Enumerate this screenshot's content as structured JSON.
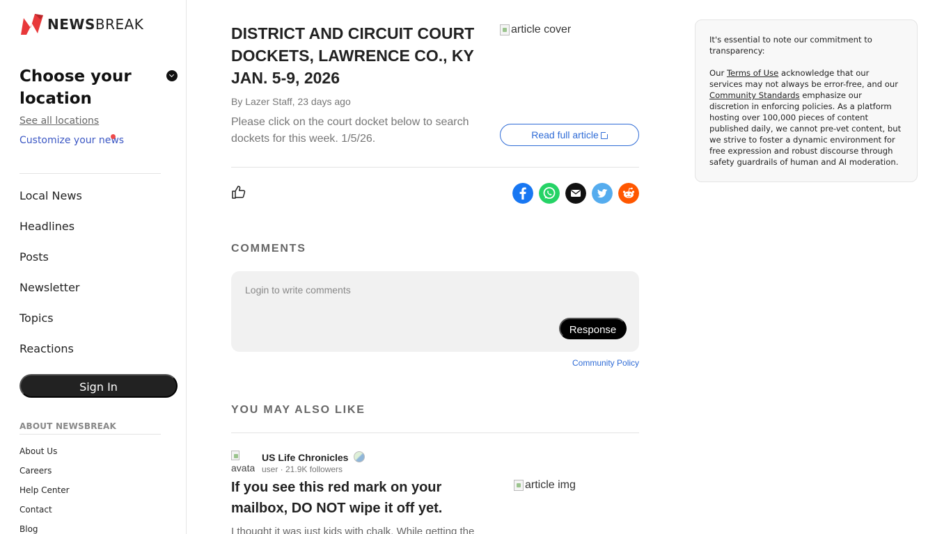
{
  "brand": {
    "name_bold": "NEWS",
    "name_rest": "BREAK"
  },
  "sidebar": {
    "location_title": "Choose your location",
    "see_all": "See all locations",
    "customize": "Customize your news",
    "nav": [
      "Local News",
      "Headlines",
      "Posts",
      "Newsletter",
      "Topics",
      "Reactions"
    ],
    "sign_in": "Sign In",
    "about_heading": "ABOUT NEWSBREAK",
    "footer_links": [
      "About Us",
      "Careers",
      "Help Center",
      "Contact",
      "Blog"
    ]
  },
  "article": {
    "title": "DISTRICT AND CIRCUIT COURT DOCKETS, LAWRENCE CO., KY JAN. 5-9, 2026",
    "cover_alt": "article cover",
    "byline": "By Lazer Staff, 23 days ago",
    "excerpt": "Please click on the court docket below to search dockets for this week. 1/5/26.",
    "read_full": "Read full article",
    "share_icons": [
      "facebook-icon",
      "whatsapp-icon",
      "email-icon",
      "twitter-icon",
      "reddit-icon"
    ]
  },
  "comments": {
    "heading": "COMMENTS",
    "placeholder": "Login to write comments",
    "response_button": "Response",
    "policy_link": "Community Policy"
  },
  "also_like": {
    "heading": "YOU MAY ALSO LIKE",
    "item": {
      "avatar_alt": "avatar",
      "source": "US Life Chronicles",
      "meta": "user · 21.9K followers",
      "title": "If you see this red mark on your mailbox, DO NOT wipe it off yet.",
      "img_alt": "article img",
      "snippet": "I thought it was just kids with chalk. While getting the"
    }
  },
  "notice": {
    "intro": "It's essential to note our commitment to transparency:",
    "p_start": "Our ",
    "terms_link": "Terms of Use",
    "p_mid": " acknowledge that our services may not always be error-free, and our ",
    "standards_link": "Community Standards",
    "p_end": " emphasize our discretion in enforcing policies. As a platform hosting over 100,000 pieces of content published daily, we cannot pre-vet content, but we strive to foster a dynamic environment for free expression and robust discourse through safety guardrails of human and AI moderation."
  },
  "colors": {
    "brand_red": "#e8383a",
    "link_blue": "#2e6bd6",
    "facebook": "#1877f2",
    "whatsapp": "#25d366",
    "email": "#111111",
    "twitter": "#55acee",
    "reddit": "#ff5700"
  }
}
